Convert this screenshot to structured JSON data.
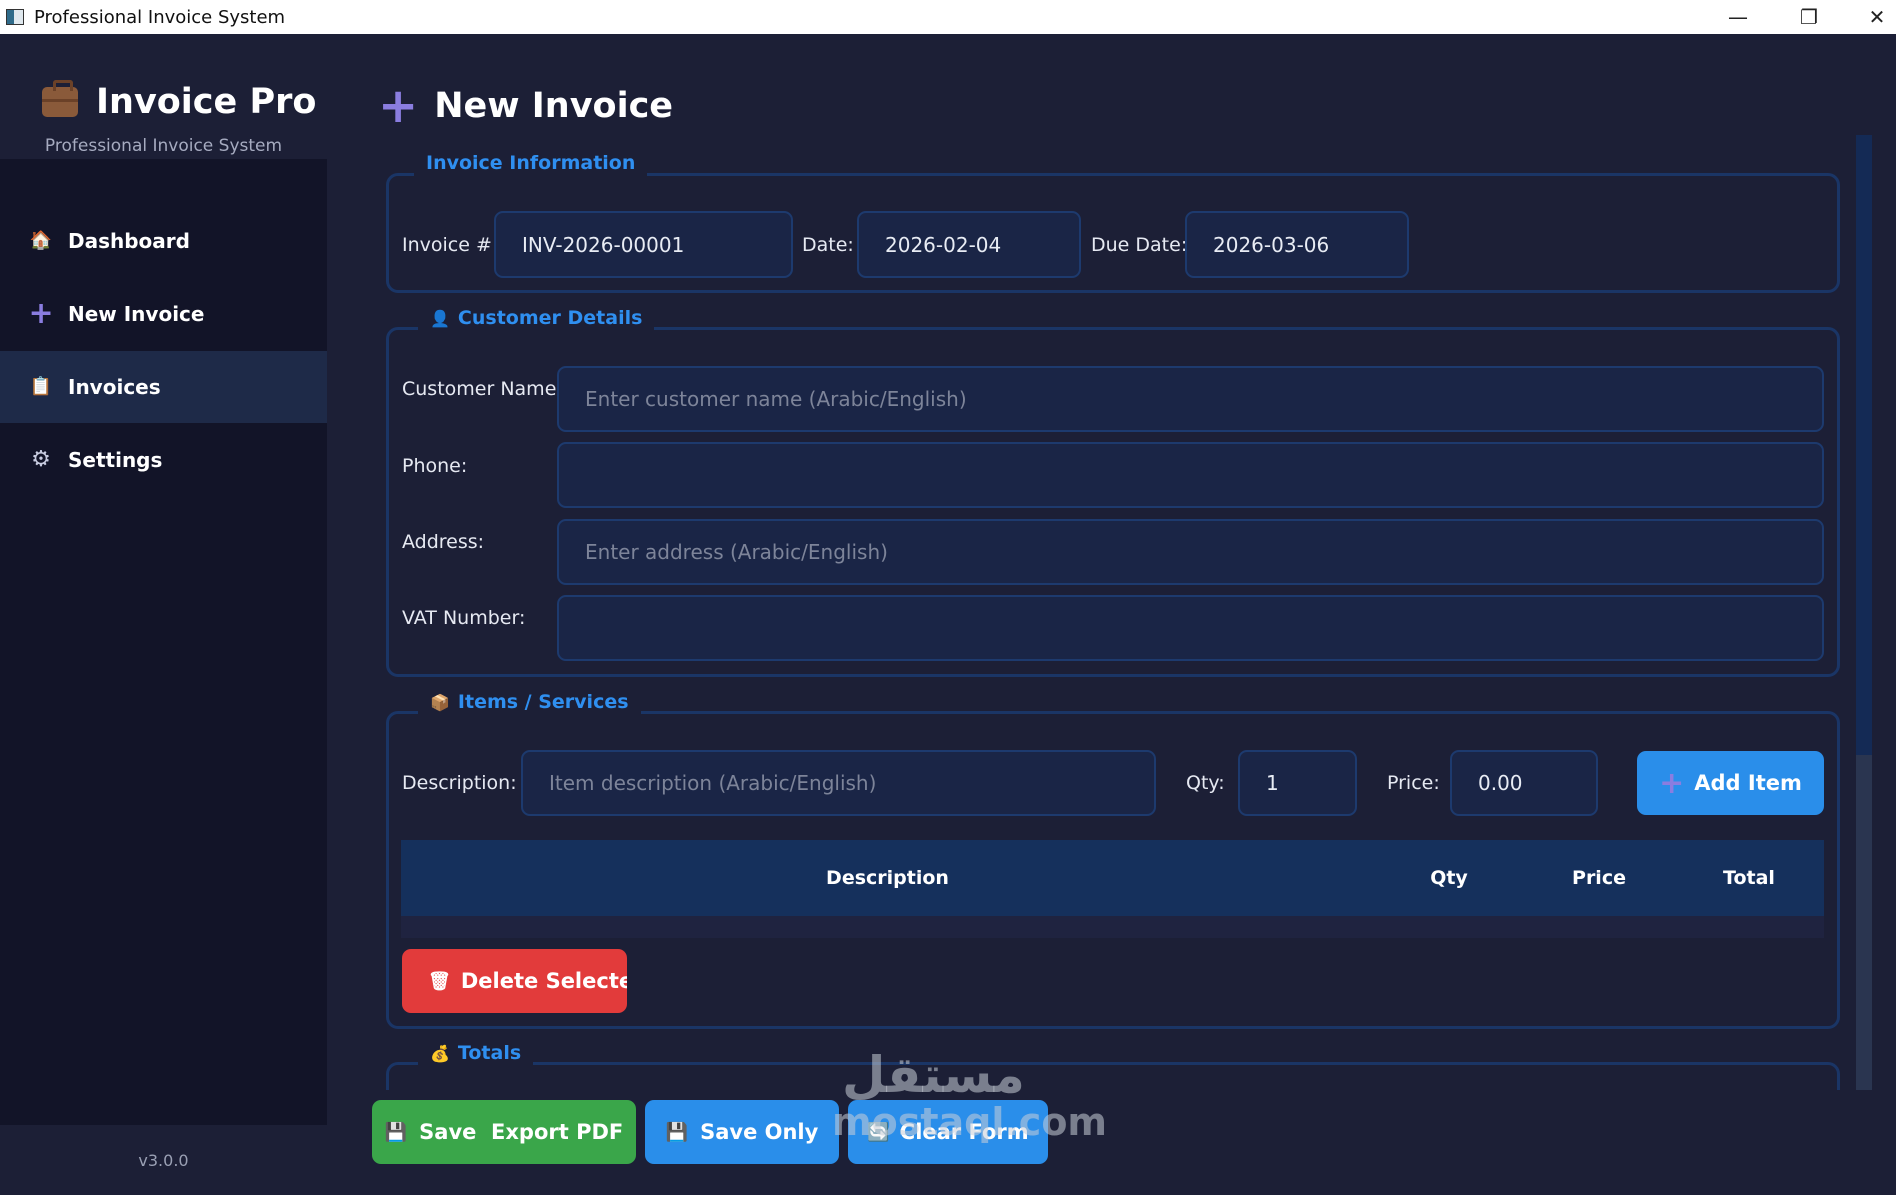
{
  "window": {
    "title": "Professional Invoice System",
    "controls": {
      "minimize": "—",
      "restore": "❐",
      "close": "✕"
    }
  },
  "sidebar": {
    "brand": "Invoice Pro",
    "brand_subtitle": "Professional Invoice System",
    "items": [
      {
        "label": "Dashboard",
        "icon": "house-icon",
        "glyph": "🏠"
      },
      {
        "label": "New Invoice",
        "icon": "plus-icon",
        "glyph": "+"
      },
      {
        "label": "Invoices",
        "icon": "clipboard-icon",
        "glyph": "📋",
        "active": true
      },
      {
        "label": "Settings",
        "icon": "gear-icon",
        "glyph": "⚙"
      }
    ],
    "version": "v3.0.0"
  },
  "page": {
    "title": "New Invoice",
    "title_glyph": "+"
  },
  "invoice_info": {
    "legend": "Invoice Information",
    "invoice_label": "Invoice #:",
    "invoice_value": "INV-2026-00001",
    "date_label": "Date:",
    "date_value": "2026-02-04",
    "due_label": "Due Date:",
    "due_value": "2026-03-06"
  },
  "customer": {
    "legend": "Customer Details",
    "legend_glyph": "👤",
    "name_label": "Customer Name:",
    "name_placeholder": "Enter customer name (Arabic/English)",
    "phone_label": "Phone:",
    "phone_value": "",
    "address_label": "Address:",
    "address_placeholder": "Enter address (Arabic/English)",
    "vat_label": "VAT Number:",
    "vat_value": ""
  },
  "items": {
    "legend": "Items / Services",
    "legend_glyph": "📦",
    "desc_label": "Description:",
    "desc_placeholder": "Item description (Arabic/English)",
    "qty_label": "Qty:",
    "qty_value": "1",
    "price_label": "Price:",
    "price_value": "0.00",
    "add_button": "Add Item",
    "add_glyph": "+",
    "table_headers": [
      "Description",
      "Qty",
      "Price",
      "Total"
    ],
    "delete_button": "Delete Selecte",
    "delete_glyph": "🗑"
  },
  "totals": {
    "legend": "Totals",
    "legend_glyph": "💰"
  },
  "actions": {
    "save_export": "Save  Export PDF",
    "save_only": "Save Only",
    "clear_form": "Clear Form",
    "save_glyph": "💾",
    "clear_glyph": "🔄"
  },
  "watermark": {
    "arabic": "مستقل",
    "latin": "mostaql.com"
  },
  "colors": {
    "background": "#1c1f36",
    "sidebar": "#121428",
    "accent_blue": "#2f8ff0",
    "button_blue": "#2a8eea",
    "button_green": "#3aa64a",
    "button_red": "#e23b3b",
    "field_bg": "#1a2546",
    "border": "#1a3566"
  }
}
